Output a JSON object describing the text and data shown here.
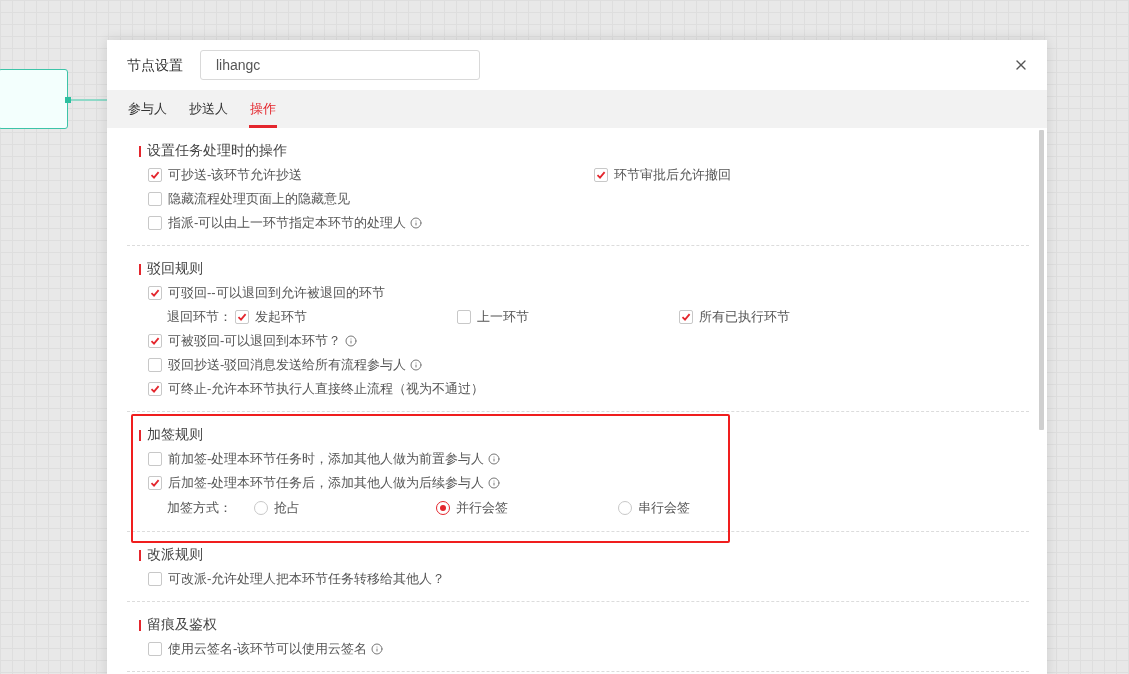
{
  "dialog": {
    "title": "节点设置",
    "name_field": {
      "value": "lihangc"
    },
    "tabs": [
      {
        "label": "参与人",
        "selected": false
      },
      {
        "label": "抄送人",
        "selected": false
      },
      {
        "label": "操作",
        "selected": true
      }
    ]
  },
  "sections": [
    {
      "title": "设置任务处理时的操作",
      "rows": [
        {
          "kind": "checkboxes",
          "items": [
            {
              "label": "可抄送-该环节允许抄送",
              "checked": true,
              "info": false
            },
            {
              "label": "环节审批后允许撤回",
              "checked": true,
              "info": false
            }
          ]
        },
        {
          "kind": "checkboxes",
          "items": [
            {
              "label": "隐藏流程处理页面上的隐藏意见",
              "checked": false,
              "info": false
            }
          ]
        },
        {
          "kind": "checkboxes",
          "items": [
            {
              "label": "指派-可以由上一环节指定本环节的处理人",
              "checked": false,
              "info": true
            }
          ]
        }
      ]
    },
    {
      "title": "驳回规则",
      "rows": [
        {
          "kind": "checkboxes",
          "items": [
            {
              "label": "可驳回--可以退回到允许被退回的环节",
              "checked": true,
              "info": false
            }
          ]
        },
        {
          "kind": "options",
          "label": "退回环节：",
          "items": [
            {
              "label": "发起环节",
              "checked": true
            },
            {
              "label": "上一环节",
              "checked": false
            },
            {
              "label": "所有已执行环节",
              "checked": true
            }
          ]
        },
        {
          "kind": "checkboxes",
          "items": [
            {
              "label": "可被驳回-可以退回到本环节？",
              "checked": true,
              "info": true
            }
          ]
        },
        {
          "kind": "checkboxes",
          "items": [
            {
              "label": "驳回抄送-驳回消息发送给所有流程参与人",
              "checked": false,
              "info": true
            }
          ]
        },
        {
          "kind": "checkboxes",
          "items": [
            {
              "label": "可终止-允许本环节执行人直接终止流程（视为不通过）",
              "checked": true,
              "info": false
            }
          ]
        }
      ]
    },
    {
      "title": "加签规则",
      "rows": [
        {
          "kind": "checkboxes",
          "items": [
            {
              "label": "前加签-处理本环节任务时，添加其他人做为前置参与人",
              "checked": false,
              "info": true
            }
          ]
        },
        {
          "kind": "checkboxes",
          "items": [
            {
              "label": "后加签-处理本环节任务后，添加其他人做为后续参与人",
              "checked": true,
              "info": true
            }
          ]
        },
        {
          "kind": "radios",
          "label": "加签方式：",
          "items": [
            {
              "label": "抢占",
              "selected": false
            },
            {
              "label": "并行会签",
              "selected": true
            },
            {
              "label": "串行会签",
              "selected": false
            }
          ]
        }
      ]
    },
    {
      "title": "改派规则",
      "rows": [
        {
          "kind": "checkboxes",
          "items": [
            {
              "label": "可改派-允许处理人把本环节任务转移给其他人？",
              "checked": false,
              "info": false
            }
          ]
        }
      ]
    },
    {
      "title": "留痕及鉴权",
      "rows": [
        {
          "kind": "checkboxes",
          "items": [
            {
              "label": "使用云签名-该环节可以使用云签名",
              "checked": false,
              "info": true
            }
          ]
        }
      ]
    }
  ]
}
